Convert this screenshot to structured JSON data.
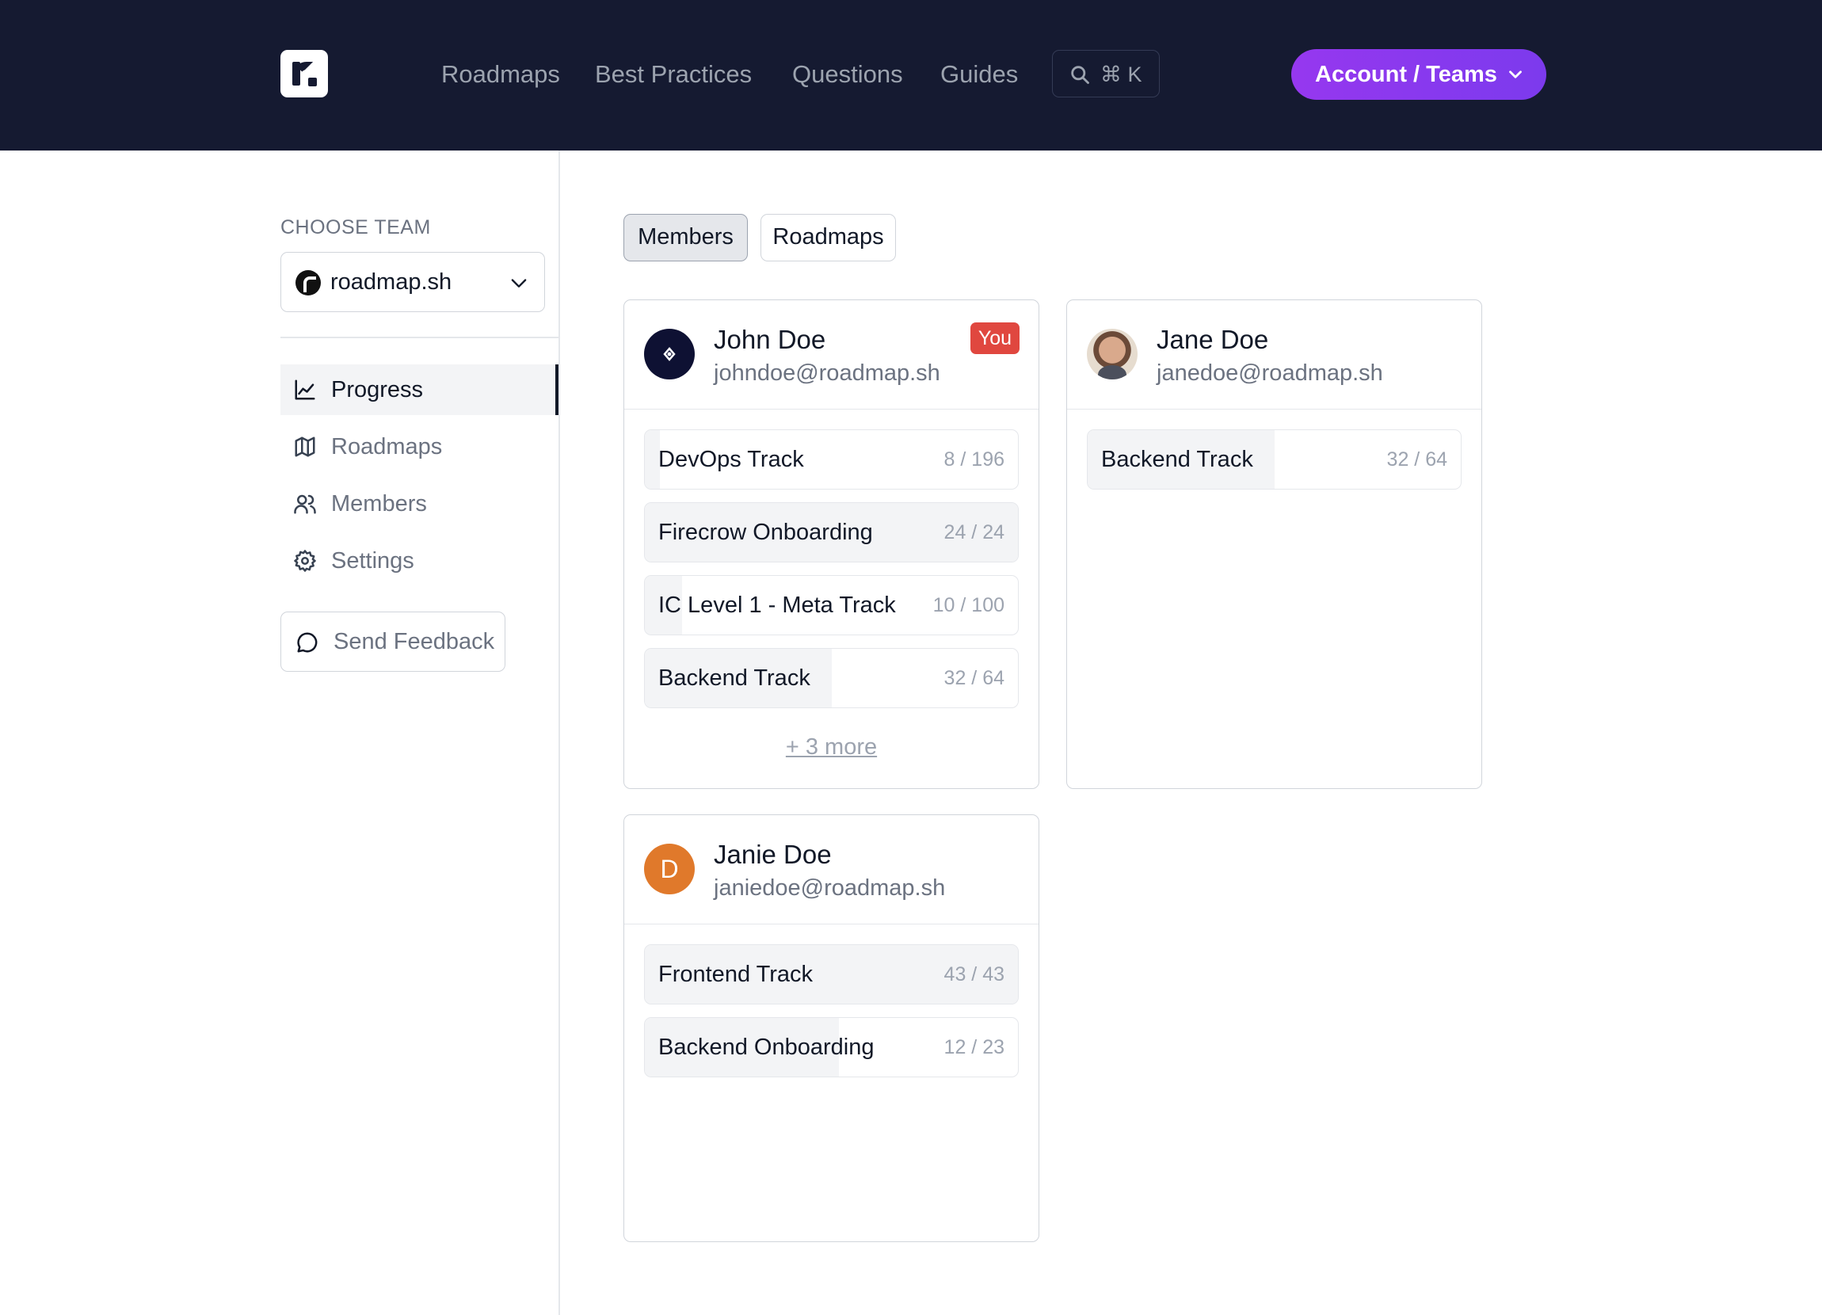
{
  "nav": {
    "links": [
      "Roadmaps",
      "Best Practices",
      "Questions",
      "Guides"
    ],
    "search_shortcut": "⌘ K",
    "account_label": "Account / Teams"
  },
  "sidebar": {
    "choose_team_label": "CHOOSE TEAM",
    "team_name": "roadmap.sh",
    "items": [
      {
        "label": "Progress",
        "icon": "chart-line-icon",
        "active": true
      },
      {
        "label": "Roadmaps",
        "icon": "map-icon",
        "active": false
      },
      {
        "label": "Members",
        "icon": "users-icon",
        "active": false
      },
      {
        "label": "Settings",
        "icon": "gear-icon",
        "active": false
      }
    ],
    "feedback_label": "Send Feedback"
  },
  "tabs": [
    {
      "label": "Members",
      "active": true
    },
    {
      "label": "Roadmaps",
      "active": false
    }
  ],
  "members": [
    {
      "name": "John Doe",
      "email": "johndoe@roadmap.sh",
      "badge": "You",
      "tracks": [
        {
          "name": "DevOps Track",
          "count": "8 / 196",
          "progress": 0.04
        },
        {
          "name": "Firecrow Onboarding",
          "count": "24 / 24",
          "progress": 1.0
        },
        {
          "name": "IC Level 1 - Meta Track",
          "count": "10 / 100",
          "progress": 0.1
        },
        {
          "name": "Backend Track",
          "count": "32 / 64",
          "progress": 0.5
        }
      ],
      "more_label": "+ 3 more"
    },
    {
      "name": "Jane Doe",
      "email": "janedoe@roadmap.sh",
      "tracks": [
        {
          "name": "Backend Track",
          "count": "32 / 64",
          "progress": 0.5
        }
      ]
    },
    {
      "name": "Janie Doe",
      "email": "janiedoe@roadmap.sh",
      "avatar_initial": "D",
      "tracks": [
        {
          "name": "Frontend Track",
          "count": "43 / 43",
          "progress": 1.0
        },
        {
          "name": "Backend Onboarding",
          "count": "12 / 23",
          "progress": 0.52
        }
      ]
    }
  ],
  "colors": {
    "nav_bg": "#151a31",
    "accent": "#9638ef",
    "you_badge": "#e0473f",
    "initial_avatar": "#e0792b"
  }
}
